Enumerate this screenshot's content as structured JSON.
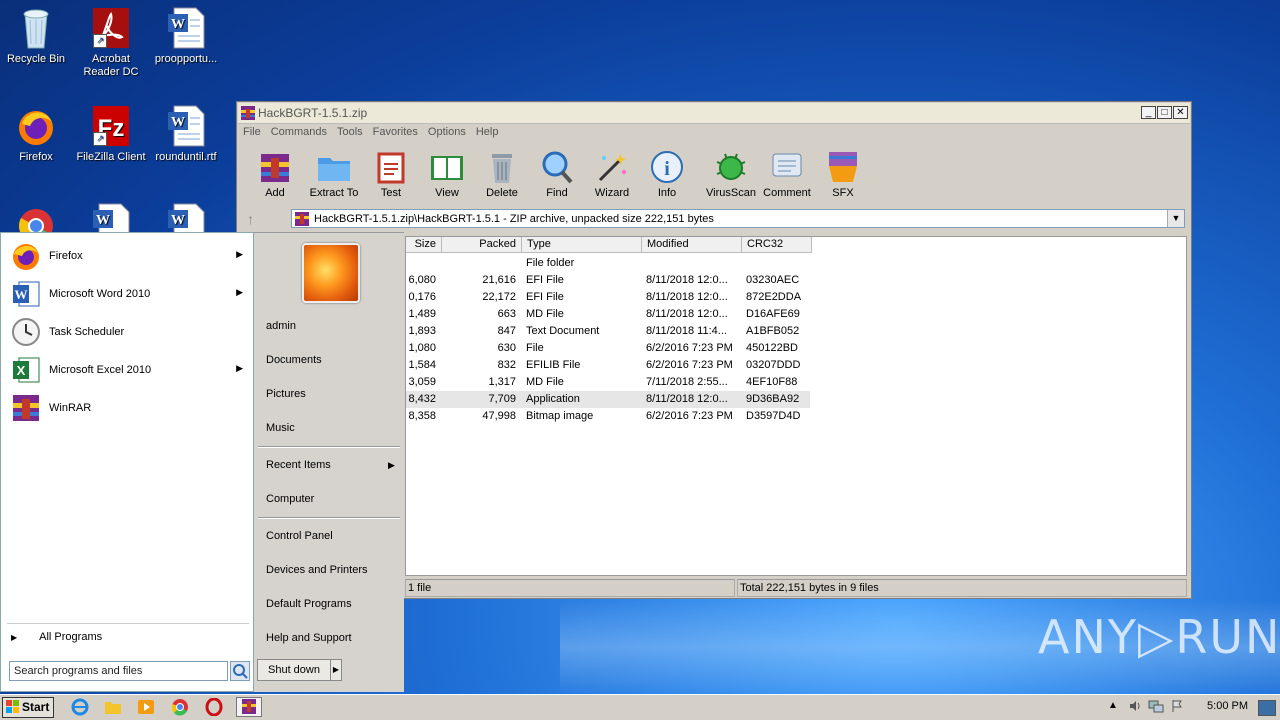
{
  "desktop": {
    "icons": [
      {
        "label": "Recycle Bin"
      },
      {
        "label": "Acrobat Reader DC"
      },
      {
        "label": "proopportu..."
      },
      {
        "label": "Firefox"
      },
      {
        "label": "FileZilla Client"
      },
      {
        "label": "rounduntil.rtf"
      }
    ]
  },
  "window": {
    "title": "HackBGRT-1.5.1.zip",
    "menu": [
      "File",
      "Commands",
      "Tools",
      "Favorites",
      "Options",
      "Help"
    ],
    "toolbar": [
      "Add",
      "Extract To",
      "Test",
      "View",
      "Delete",
      "Find",
      "Wizard",
      "Info",
      "VirusScan",
      "Comment",
      "SFX"
    ],
    "address": "HackBGRT-1.5.1.zip\\HackBGRT-1.5.1 - ZIP archive, unpacked size 222,151 bytes",
    "columns": [
      "Size",
      "Packed",
      "Type",
      "Modified",
      "CRC32"
    ],
    "rows": [
      {
        "size": "",
        "packed": "",
        "type": "File folder",
        "modified": "",
        "crc": ""
      },
      {
        "size": "6,080",
        "packed": "21,616",
        "type": "EFI File",
        "modified": "8/11/2018 12:0...",
        "crc": "03230AEC"
      },
      {
        "size": "0,176",
        "packed": "22,172",
        "type": "EFI File",
        "modified": "8/11/2018 12:0...",
        "crc": "872E2DDA"
      },
      {
        "size": "1,489",
        "packed": "663",
        "type": "MD File",
        "modified": "8/11/2018 12:0...",
        "crc": "D16AFE69"
      },
      {
        "size": "1,893",
        "packed": "847",
        "type": "Text Document",
        "modified": "8/11/2018 11:4...",
        "crc": "A1BFB052"
      },
      {
        "size": "1,080",
        "packed": "630",
        "type": "File",
        "modified": "6/2/2016 7:23 PM",
        "crc": "450122BD"
      },
      {
        "size": "1,584",
        "packed": "832",
        "type": "EFILIB File",
        "modified": "6/2/2016 7:23 PM",
        "crc": "03207DDD"
      },
      {
        "size": "3,059",
        "packed": "1,317",
        "type": "MD File",
        "modified": "7/11/2018 2:55...",
        "crc": "4EF10F88"
      },
      {
        "size": "8,432",
        "packed": "7,709",
        "type": "Application",
        "modified": "8/11/2018 12:0...",
        "crc": "9D36BA92"
      },
      {
        "size": "8,358",
        "packed": "47,998",
        "type": "Bitmap image",
        "modified": "6/2/2016 7:23 PM",
        "crc": "D3597D4D"
      }
    ],
    "status_left": "1 file",
    "status_right": "Total 222,151 bytes in 9 files"
  },
  "startmenu": {
    "programs": [
      "Firefox",
      "Microsoft Word 2010",
      "Task Scheduler",
      "Microsoft Excel 2010",
      "WinRAR"
    ],
    "all_programs": "All Programs",
    "search_placeholder": "Search programs and files",
    "right": {
      "user": "admin",
      "documents": "Documents",
      "pictures": "Pictures",
      "music": "Music",
      "recent": "Recent Items",
      "computer": "Computer",
      "control_panel": "Control Panel",
      "devices": "Devices and Printers",
      "default_programs": "Default Programs",
      "help": "Help and Support"
    },
    "shutdown": "Shut down"
  },
  "taskbar": {
    "start": "Start",
    "clock": "5:00 PM"
  },
  "watermark": "ANY▷RUN"
}
